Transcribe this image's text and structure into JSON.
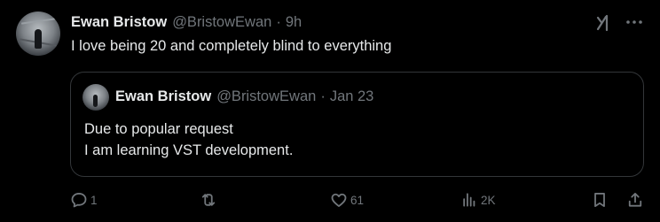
{
  "post": {
    "author_name": "Ewan Bristow",
    "handle": "@BristowEwan",
    "separator": "·",
    "time": "9h",
    "text": "I love being 20 and completely blind to everything"
  },
  "quoted_post": {
    "author_name": "Ewan Bristow",
    "handle": "@BristowEwan",
    "separator": "·",
    "date": "Jan 23",
    "lines": [
      "Due to popular request",
      "I am learning VST development."
    ]
  },
  "actions": {
    "replies": "1",
    "reposts": "",
    "likes": "61",
    "views": "2K"
  },
  "icons": {
    "grok": "grok-icon",
    "more": "more-icon",
    "reply": "reply-icon",
    "repost": "repost-icon",
    "like": "heart-icon",
    "views": "views-icon",
    "bookmark": "bookmark-icon",
    "share": "share-icon"
  },
  "colors": {
    "background": "#000000",
    "text_primary": "#e7e9ea",
    "text_secondary": "#71767b",
    "border": "#333639"
  }
}
